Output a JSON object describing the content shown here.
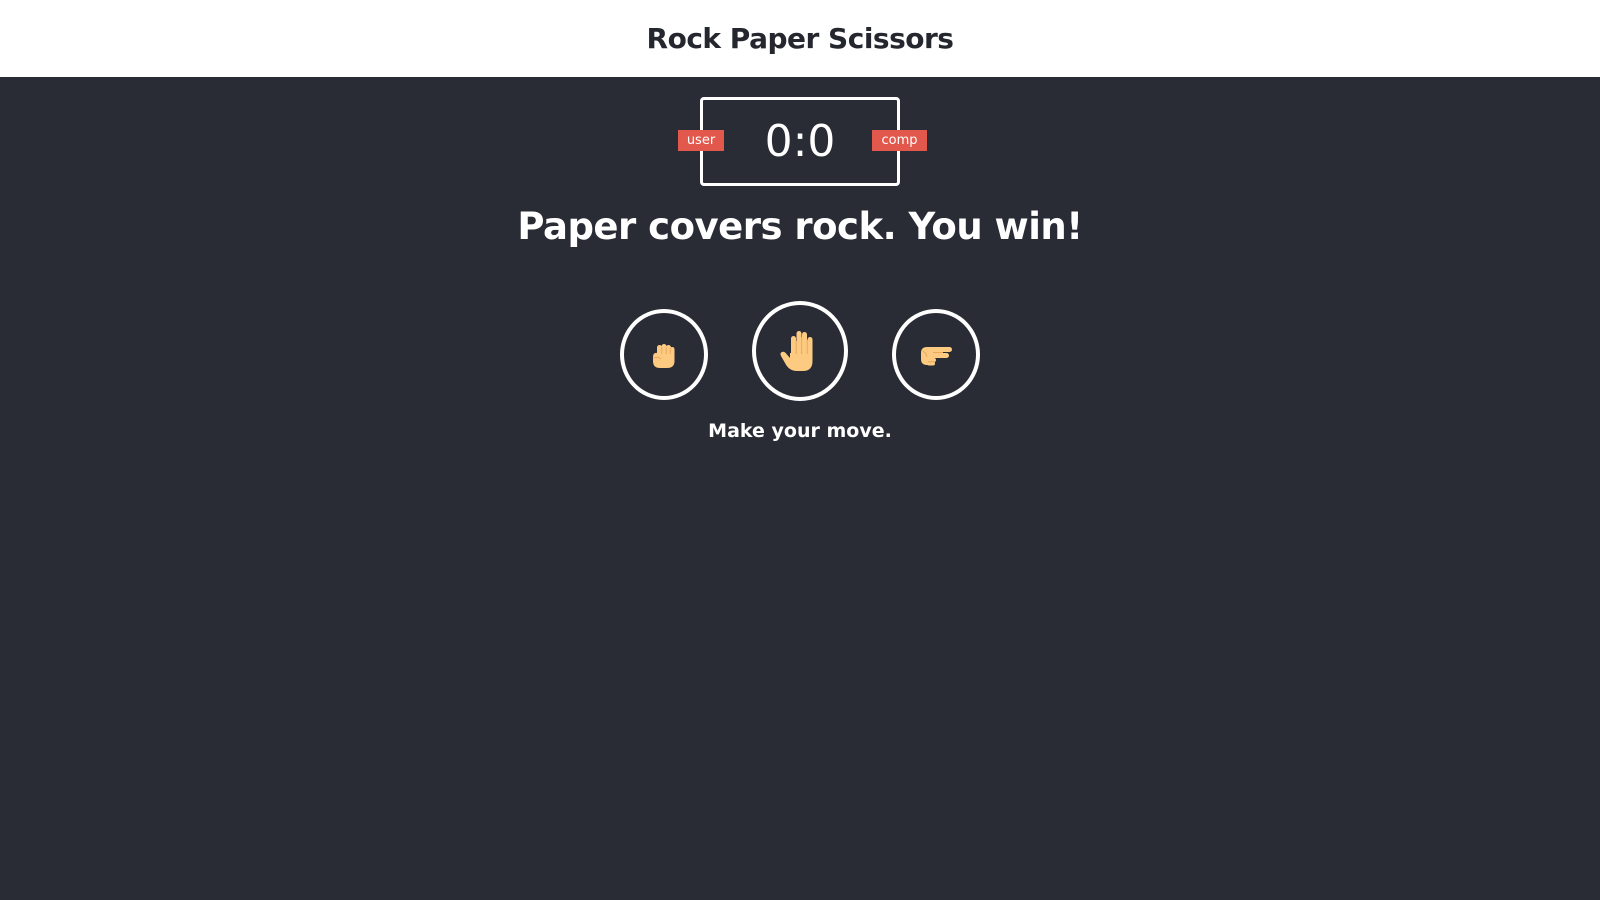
{
  "header": {
    "title": "Rock Paper Scissors"
  },
  "scoreboard": {
    "user_label": "user",
    "comp_label": "comp",
    "score": "0:0",
    "user_score": 0,
    "comp_score": 0
  },
  "result": {
    "message": "Paper covers rock. You win!"
  },
  "choices": [
    {
      "id": "rock",
      "icon": "fist-icon"
    },
    {
      "id": "paper",
      "icon": "raised-hand-icon"
    },
    {
      "id": "scissors",
      "icon": "victory-hand-icon"
    }
  ],
  "action": {
    "message": "Make your move."
  },
  "colors": {
    "background": "#292c35",
    "header_background": "#ffffff",
    "header_text": "#24272e",
    "badge": "#e2584d",
    "border": "#ffffff",
    "skin": "#fdca81"
  }
}
